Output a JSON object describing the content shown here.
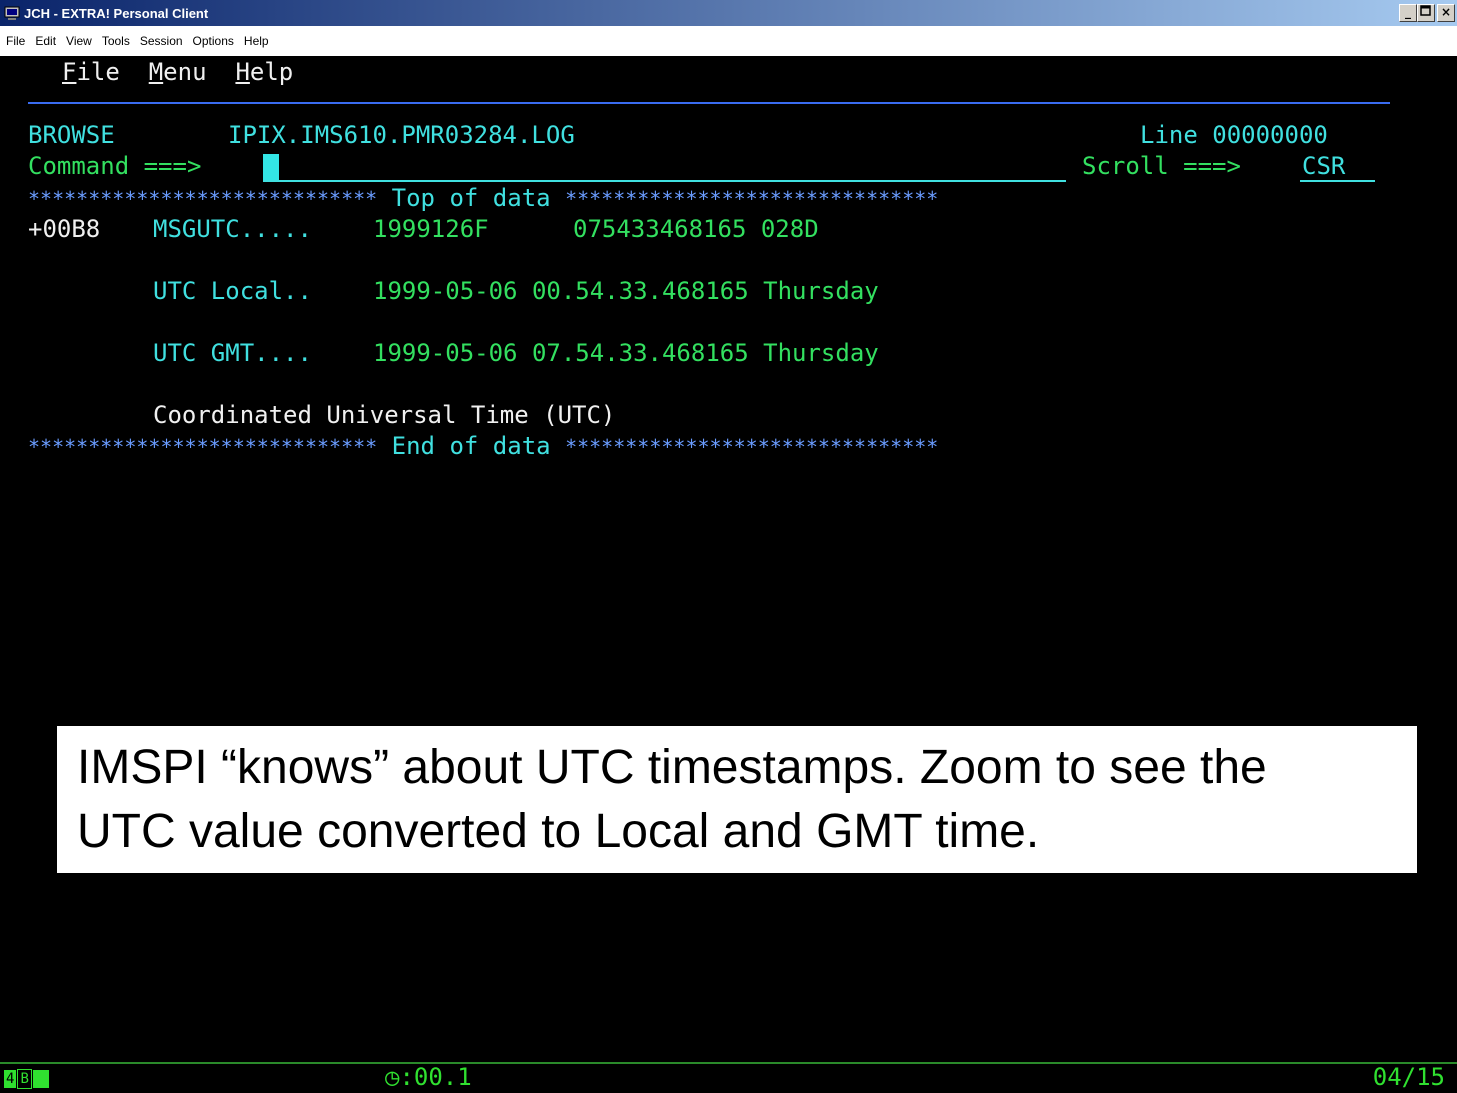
{
  "window": {
    "title": "JCH - EXTRA! Personal Client",
    "min_label": "_",
    "max_label": " ",
    "close_label": "×"
  },
  "menubar": [
    "File",
    "Edit",
    "View",
    "Tools",
    "Session",
    "Options",
    "Help"
  ],
  "terminal": {
    "action_bar": {
      "file_first": "F",
      "file_rest": "ile",
      "menu_first": "M",
      "menu_rest": "enu",
      "help_first": "H",
      "help_rest": "elp"
    },
    "header": {
      "mode": "BROWSE",
      "dataset": "IPIX.IMS610.PMR03284.LOG",
      "line": "Line 00000000"
    },
    "command_label": "Command ===>",
    "command_value": "",
    "scroll_label": "Scroll ===>",
    "scroll_value": "CSR",
    "top_line_stars_left": "*****************************",
    "top_text": "Top of data",
    "top_line_stars_right": "*******************************",
    "rows": [
      {
        "offset": "+00B8",
        "field": "MSGUTC.....",
        "value1": "1999126F",
        "value2": "075433468165 028D"
      },
      {
        "field": "UTC Local..",
        "value": "1999-05-06 00.54.33.468165 Thursday"
      },
      {
        "field": "UTC GMT....",
        "value": "1999-05-06 07.54.33.468165 Thursday"
      },
      {
        "text": "Coordinated Universal Time (UTC)"
      }
    ],
    "end_line_stars_left": "*****************************",
    "end_text": "End of data",
    "end_line_stars_right": "*******************************"
  },
  "callout": {
    "line1": "IMSPI “knows” about UTC timestamps. Zoom to see the",
    "line2": "UTC value converted to Local and GMT time."
  },
  "statusbar": {
    "chip1": "4",
    "chip2": "B",
    "time": "◷:00.1",
    "position": "04/15"
  },
  "colors": {
    "cyan": "#40e0e0",
    "green": "#33e060",
    "white": "#f0f0f0",
    "blue": "#3a6cf0"
  }
}
